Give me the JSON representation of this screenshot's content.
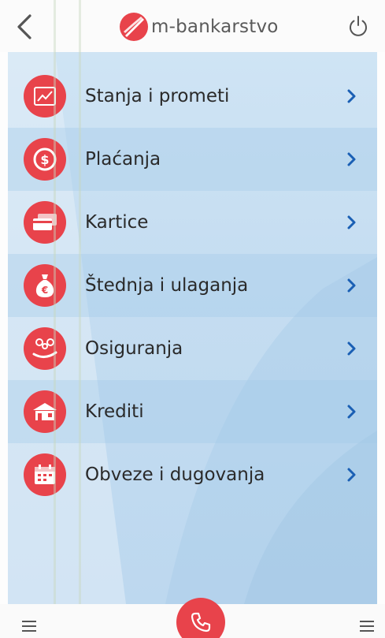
{
  "header": {
    "back_icon": "chevron-left-icon",
    "title": "m-bankarstvo",
    "power_icon": "power-icon"
  },
  "menu": {
    "items": [
      {
        "label": "Stanja i prometi",
        "icon": "chart-icon"
      },
      {
        "label": "Plaćanja",
        "icon": "dollar-coin-icon"
      },
      {
        "label": "Kartice",
        "icon": "cards-icon"
      },
      {
        "label": "Štednja i ulaganja",
        "icon": "money-bag-icon"
      },
      {
        "label": "Osiguranja",
        "icon": "people-hand-icon"
      },
      {
        "label": "Krediti",
        "icon": "house-icon"
      },
      {
        "label": "Obveze i dugovanja",
        "icon": "calendar-icon"
      }
    ]
  },
  "bottom": {
    "left_icon": "menu-icon",
    "call_icon": "phone-icon",
    "right_icon": "menu-icon"
  },
  "colors": {
    "accent": "#e8434b",
    "chevron": "#1a5fb4",
    "background": "#c9e0f3"
  }
}
